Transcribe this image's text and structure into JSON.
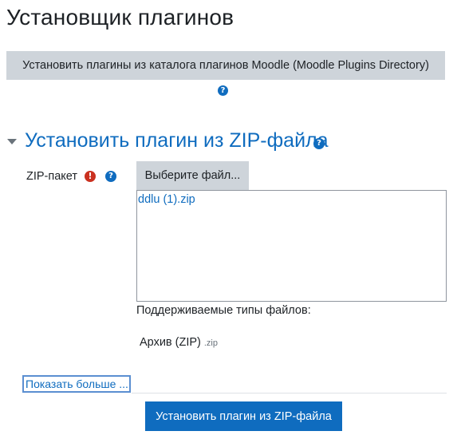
{
  "page": {
    "title": "Установщик плагинов"
  },
  "directory": {
    "button_label": "Установить плагины из каталога плагинов Moodle (Moodle Plugins Directory)",
    "help_icon": "question-circle-icon"
  },
  "zip_section": {
    "title": "Установить плагин из ZIP-файла",
    "help_icon": "question-circle-icon",
    "toggle_icon": "caret-down-icon",
    "field": {
      "label": "ZIP-пакет",
      "required_icon": "exclamation-circle-icon",
      "help_icon": "question-circle-icon",
      "choose_file_label": "Выберите файл...",
      "file_name": "ddlu (1).zip",
      "accepted_types_label": "Поддерживаемые типы файлов:",
      "accepted_type_name": "Архив (ZIP)",
      "accepted_type_ext": ".zip"
    },
    "show_more_label": "Показать больше ...",
    "submit_label": "Установить плагин из ZIP-файла"
  },
  "colors": {
    "accent": "#0f6cbf",
    "button_gray": "#ced4da",
    "required": "#ca3120"
  }
}
